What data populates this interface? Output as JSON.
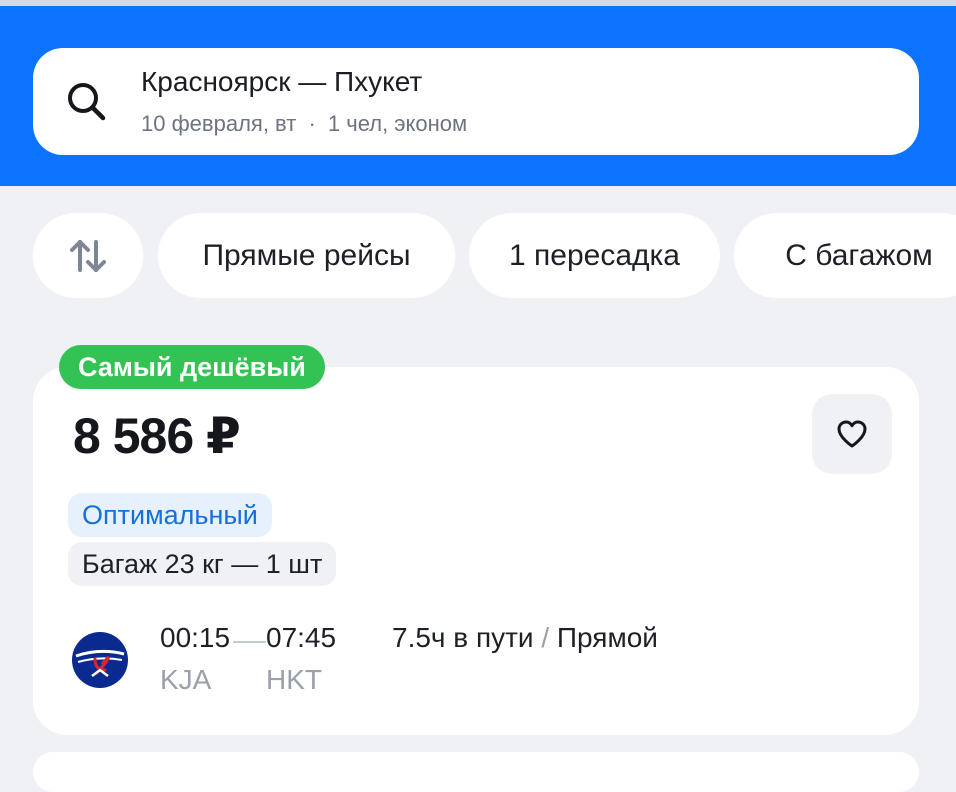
{
  "search": {
    "route": "Красноярск — Пхукет",
    "date": "10 февраля, вт",
    "separator": "·",
    "passengers": "1 чел, эконом"
  },
  "filters": {
    "sort_icon": "sort-arrows-icon",
    "chips": [
      "Прямые рейсы",
      "1 пересадка",
      "С багажом"
    ]
  },
  "offer": {
    "badge": "Самый дешёвый",
    "price": "8 586 ₽",
    "tags": [
      "Оптимальный",
      "Багаж 23 кг — 1 шт"
    ],
    "airline_logo": "aeroflot-logo",
    "departure_time": "00:15",
    "arrival_time": "07:45",
    "departure_airport": "KJA",
    "arrival_airport": "HKT",
    "duration": "7.5ч в пути",
    "slash": " / ",
    "flight_type": "Прямой"
  },
  "colors": {
    "header_blue": "#0c73fe",
    "badge_green": "#33c355",
    "optimal_tag_text": "#1670d9",
    "optimal_tag_bg": "#e6f1fd",
    "aeroflot_navy": "#0a2a8f"
  }
}
